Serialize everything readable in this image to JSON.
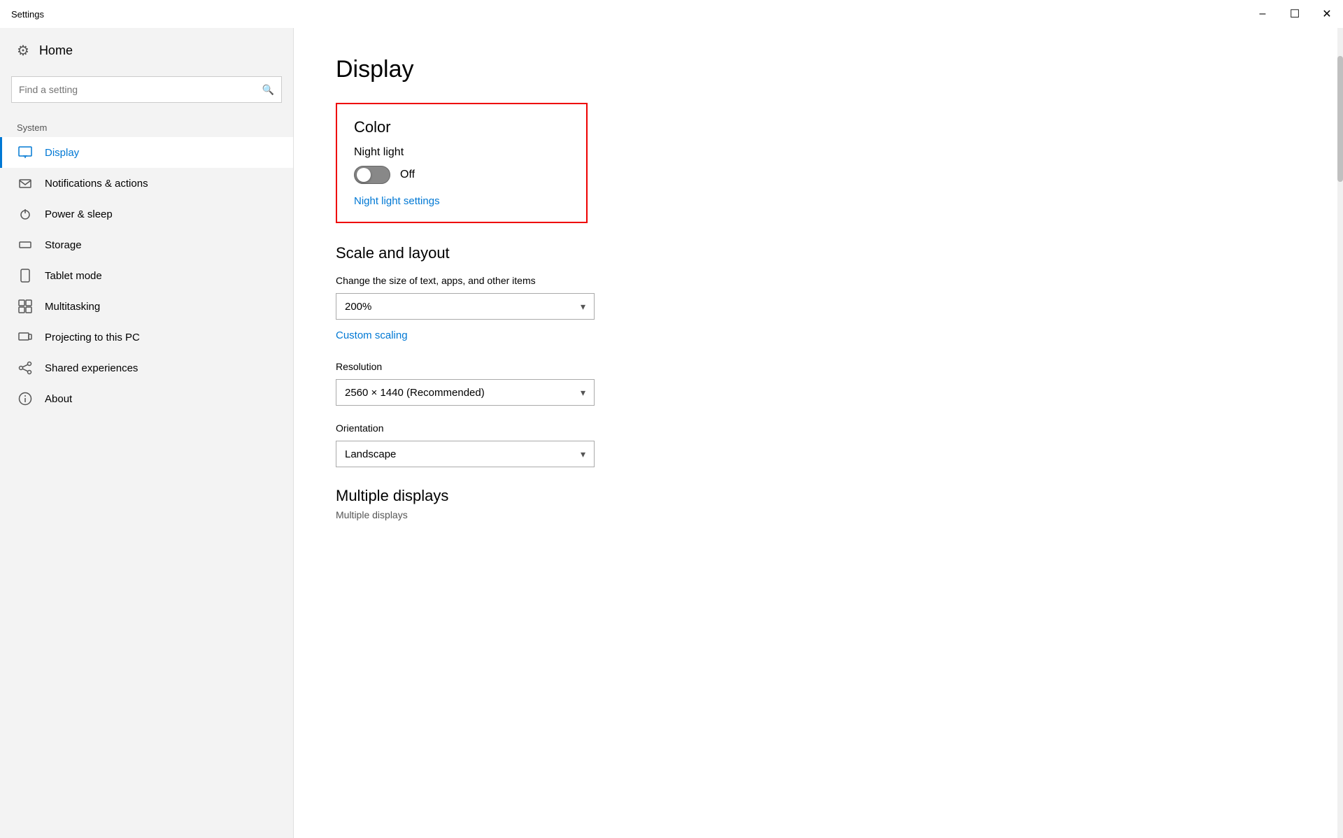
{
  "titlebar": {
    "title": "Settings",
    "minimize_label": "–",
    "maximize_label": "☐",
    "close_label": "✕"
  },
  "sidebar": {
    "home_label": "Home",
    "search_placeholder": "Find a setting",
    "section_label": "System",
    "nav_items": [
      {
        "id": "display",
        "label": "Display",
        "icon": "🖥",
        "active": true
      },
      {
        "id": "notifications",
        "label": "Notifications & actions",
        "icon": "🔔",
        "active": false
      },
      {
        "id": "power",
        "label": "Power & sleep",
        "icon": "⏻",
        "active": false
      },
      {
        "id": "storage",
        "label": "Storage",
        "icon": "💾",
        "active": false
      },
      {
        "id": "tablet",
        "label": "Tablet mode",
        "icon": "📱",
        "active": false
      },
      {
        "id": "multitasking",
        "label": "Multitasking",
        "icon": "⊞",
        "active": false
      },
      {
        "id": "projecting",
        "label": "Projecting to this PC",
        "icon": "🖨",
        "active": false
      },
      {
        "id": "shared",
        "label": "Shared experiences",
        "icon": "✂",
        "active": false
      },
      {
        "id": "about",
        "label": "About",
        "icon": "ℹ",
        "active": false
      }
    ]
  },
  "content": {
    "page_title": "Display",
    "color_section": {
      "heading": "Color",
      "night_light_label": "Night light",
      "toggle_state": "Off",
      "night_light_settings_link": "Night light settings"
    },
    "scale_layout": {
      "heading": "Scale and layout",
      "change_size_label": "Change the size of text, apps, and other items",
      "scale_value": "200%",
      "custom_scaling_link": "Custom scaling",
      "resolution_label": "Resolution",
      "resolution_value": "2560 × 1440 (Recommended)",
      "orientation_label": "Orientation",
      "orientation_value": "Landscape"
    },
    "multiple_displays": {
      "heading": "Multiple displays",
      "sub_label": "Multiple displays"
    }
  }
}
